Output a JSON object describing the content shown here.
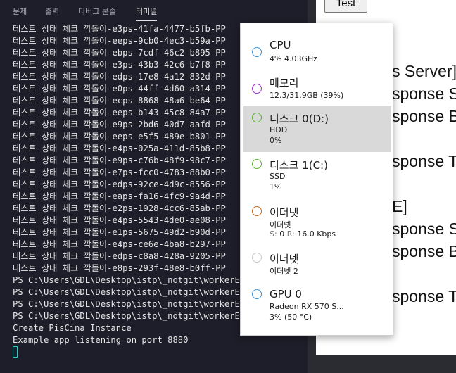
{
  "tabs": [
    "문제",
    "출력",
    "디버그 콘솔",
    "터미널"
  ],
  "terminal": {
    "lines": [
      "테스트 상태 체크 깍돌이-e3ps-41fa-4477-b5fb-PP",
      "테스트 상태 체크 깍돌이-eeps-9cb0-4ec3-b59a-PP",
      "테스트 상태 체크 깍돌이-ebps-7cdf-46c2-b895-PP",
      "테스트 상태 체크 깍돌이-e3ps-43b3-42c6-b7f8-PP",
      "테스트 상태 체크 깍돌이-edps-17e8-4a12-832d-PP",
      "테스트 상태 체크 깍돌이-e0ps-44ff-4d60-a314-PP",
      "테스트 상태 체크 깍돌이-ecps-8868-48a6-be64-PP",
      "테스트 상태 체크 깍돌이-eeps-b143-45c8-84a7-PP",
      "테스트 상태 체크 깍돌이-e9ps-2bd6-40d7-aafd-PP",
      "테스트 상태 체크 깍돌이-eeps-e5f5-489e-b801-PP",
      "테스트 상태 체크 깍돌이-e4ps-025a-411d-85b8-PP",
      "테스트 상태 체크 깍돌이-e9ps-c76b-48f9-98c7-PP",
      "테스트 상태 체크 깍돌이-e7ps-fcc0-4783-88b0-PP",
      "테스트 상태 체크 깍돌이-edps-92ce-4d9c-8556-PP",
      "테스트 상태 체크 깍돌이-eaps-fa16-4fc9-9a4d-PP",
      "테스트 상태 체크 깍돌이-e2ps-1928-4cc6-85ab-PP",
      "테스트 상태 체크 깍돌이-e4ps-5543-4de0-ae08-PP",
      "테스트 상태 체크 깍돌이-e1ps-5675-49d2-b90d-PP",
      "테스트 상태 체크 깍돌이-e4ps-ce6e-4ba8-b297-PP",
      "테스트 상태 체크 깍돌이-edps-c8a8-428a-9205-PP",
      "테스트 상태 체크 깍돌이-e8ps-293f-48e8-b0ff-PP",
      "PS C:\\Users\\GDL\\Desktop\\istp\\_notgit\\workerExa",
      "PS C:\\Users\\GDL\\Desktop\\istp\\_notgit\\workerExa",
      "PS C:\\Users\\GDL\\Desktop\\istp\\_notgit\\workerExa",
      "PS C:\\Users\\GDL\\Desktop\\istp\\_notgit\\workerExa",
      "Create PisCina Instance",
      "Example app listening on port 8880"
    ]
  },
  "browser": {
    "test_button": "Test",
    "lines": [
      "s Server]",
      "sponse S",
      "sponse B",
      "sponse T",
      "E]",
      "sponse S",
      "sponse B",
      "sponse T"
    ]
  },
  "perf": [
    {
      "title": "CPU",
      "sub1": "4% 4.03GHz",
      "sub2": "",
      "color": "#3a96dd"
    },
    {
      "title": "메모리",
      "sub1": "12.3/31.9GB (39%)",
      "sub2": "",
      "color": "#9a2fc9"
    },
    {
      "title": "디스크 0(D:)",
      "sub1": "HDD",
      "sub2": "0%",
      "color": "#59b32a"
    },
    {
      "title": "디스크 1(C:)",
      "sub1": "SSD",
      "sub2": "1%",
      "color": "#59b32a"
    },
    {
      "title": "이더넷",
      "sub1": "이더넷",
      "sub2_k1": "S:",
      "sub2_v1": "0",
      "sub2_k2": "R:",
      "sub2_v2": "16.0 Kbps",
      "color": "#c56a1d"
    },
    {
      "title": "이더넷",
      "sub1": "이더넷 2",
      "sub2": "",
      "color": "#c8c8c8"
    },
    {
      "title": "GPU 0",
      "sub1": "Radeon RX 570 S...",
      "sub2": "3% (50 °C)",
      "color": "#3a96dd"
    }
  ]
}
